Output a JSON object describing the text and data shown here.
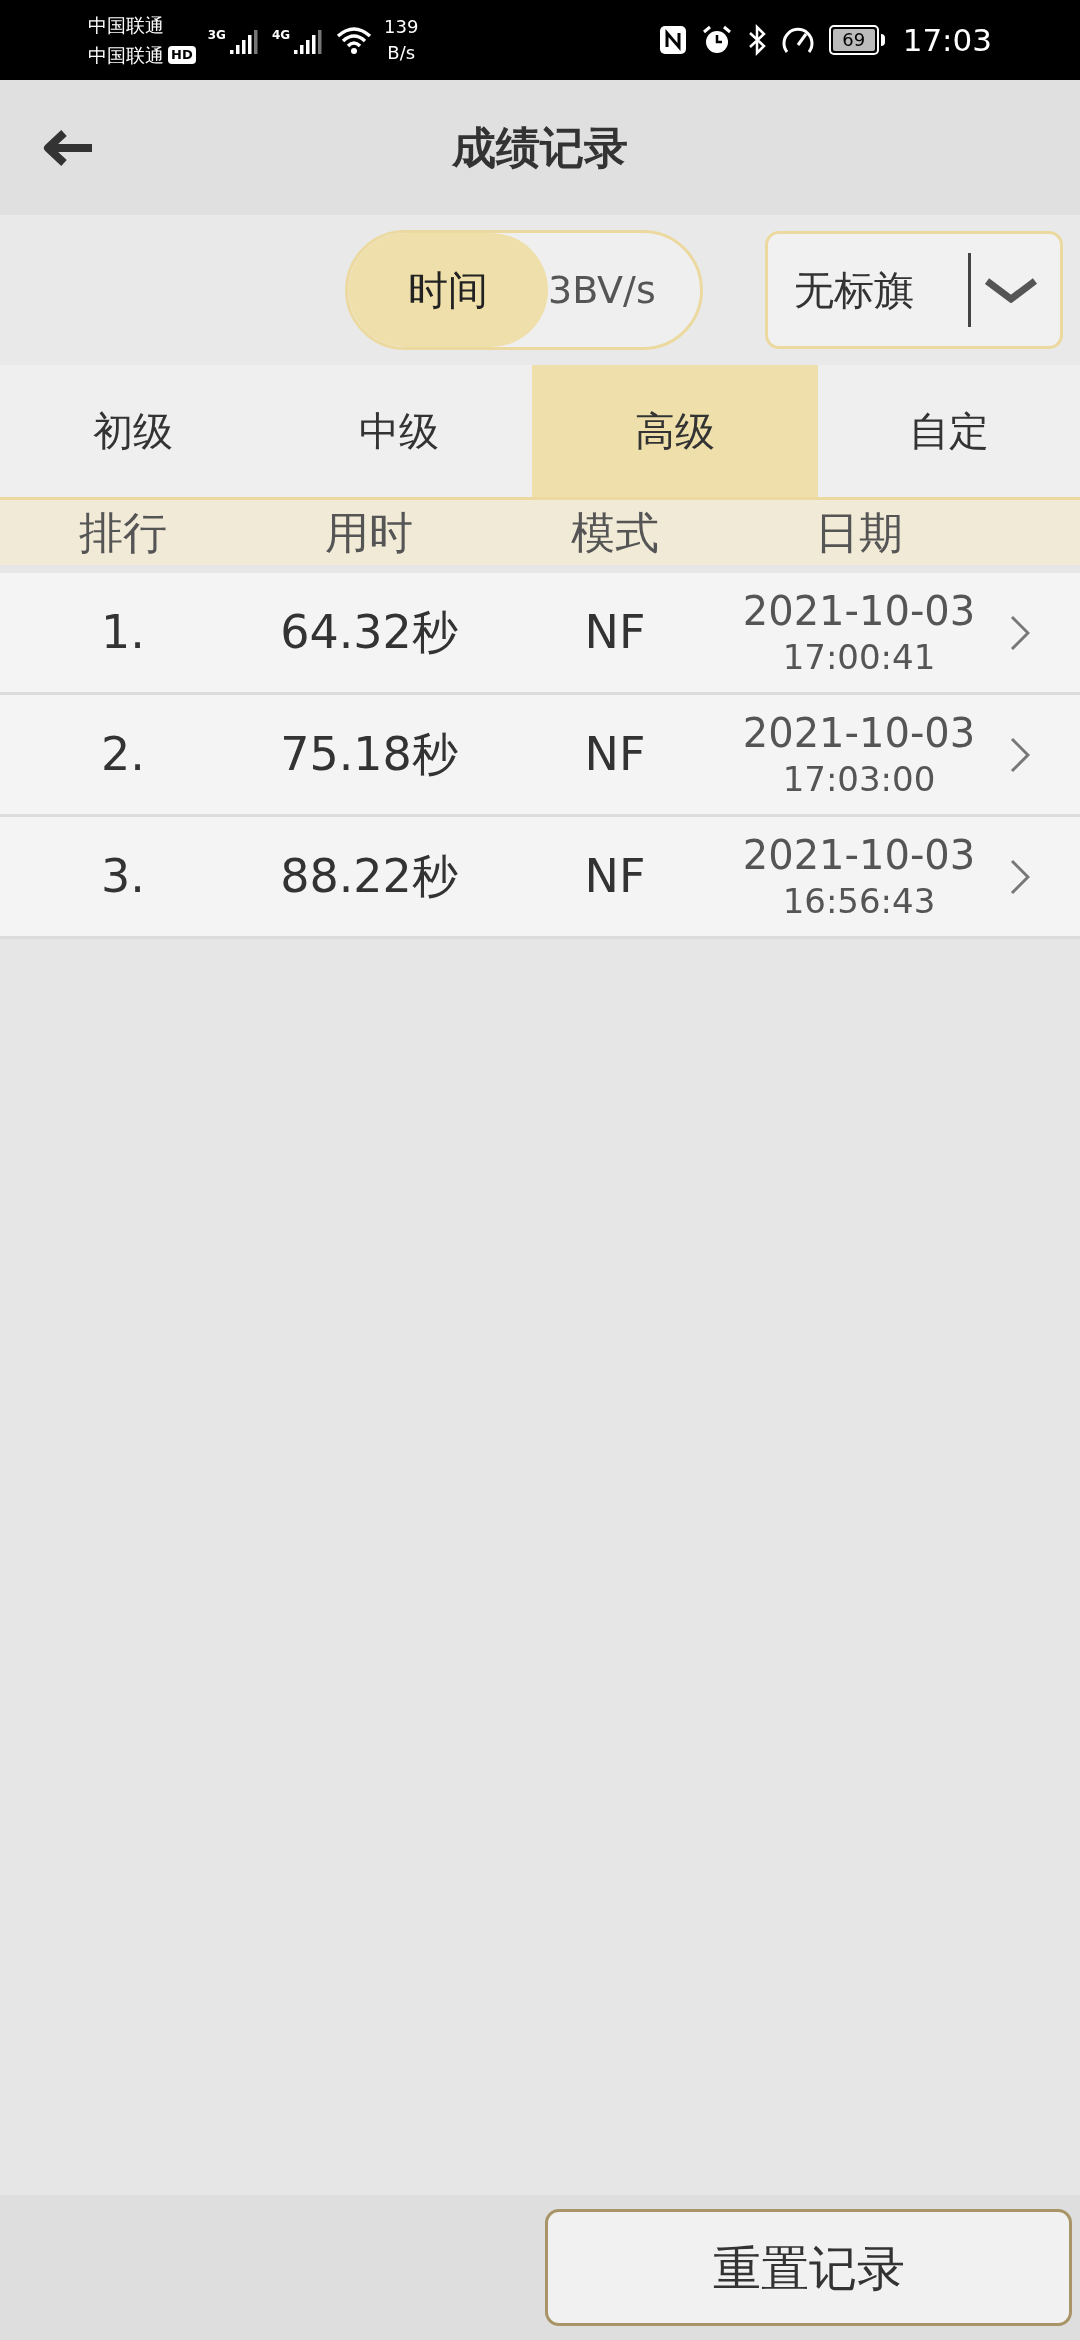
{
  "status_bar": {
    "carrier_1": "中国联通",
    "carrier_2": "中国联通",
    "hd_badge": "HD",
    "network_1": "3G",
    "network_2": "4G",
    "speed_value": "139",
    "speed_unit": "B/s",
    "battery": "69",
    "time": "17:03"
  },
  "header": {
    "title": "成绩记录"
  },
  "sort_toggle": [
    {
      "label": "时间",
      "selected": true
    },
    {
      "label": "3BV/s",
      "selected": false
    }
  ],
  "flag_filter": {
    "value": "无标旗"
  },
  "tabs": [
    {
      "label": "初级",
      "selected": false
    },
    {
      "label": "中级",
      "selected": false
    },
    {
      "label": "高级",
      "selected": true
    },
    {
      "label": "自定",
      "selected": false
    }
  ],
  "table": {
    "columns": [
      "排行",
      "用时",
      "模式",
      "日期"
    ],
    "rows": [
      {
        "rank": "1.",
        "time": "64.32秒",
        "mode": "NF",
        "date": "2021-10-03",
        "clock": "17:00:41"
      },
      {
        "rank": "2.",
        "time": "75.18秒",
        "mode": "NF",
        "date": "2021-10-03",
        "clock": "17:03:00"
      },
      {
        "rank": "3.",
        "time": "88.22秒",
        "mode": "NF",
        "date": "2021-10-03",
        "clock": "16:56:43"
      }
    ]
  },
  "reset_button": "重置记录"
}
